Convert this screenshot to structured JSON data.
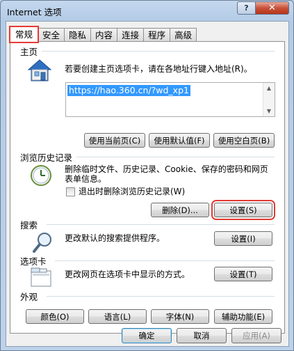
{
  "window": {
    "title": "Internet 选项",
    "help_label": "?",
    "close_label": "✕"
  },
  "tabs": [
    {
      "label": "常规"
    },
    {
      "label": "安全"
    },
    {
      "label": "隐私"
    },
    {
      "label": "内容"
    },
    {
      "label": "连接"
    },
    {
      "label": "程序"
    },
    {
      "label": "高级"
    }
  ],
  "homepage": {
    "section_title": "主页",
    "description": "若要创建主页选项卡，请在各地址行键入地址(R)。",
    "url": "https://hao.360.cn/?wd_xp1",
    "btn_current": "使用当前页(C)",
    "btn_default": "使用默认值(F)",
    "btn_blank": "使用空白页(B)"
  },
  "history": {
    "section_title": "浏览历史记录",
    "description_line1": "删除临时文件、历史记录、Cookie、保存的密码和网页",
    "description_line2": "表单信息。",
    "checkbox_label": "退出时删除浏览历史记录(W)",
    "btn_delete": "删除(D)...",
    "btn_settings": "设置(S)"
  },
  "search": {
    "section_title": "搜索",
    "description": "更改默认的搜索提供程序。",
    "btn_settings": "设置(I)"
  },
  "tabs_section": {
    "section_title": "选项卡",
    "description": "更改网页在选项卡中显示的方式。",
    "btn_settings": "设置(T)"
  },
  "appearance": {
    "section_title": "外观",
    "btn_colors": "颜色(O)",
    "btn_languages": "语言(L)",
    "btn_fonts": "字体(N)",
    "btn_accessibility": "辅助功能(E)"
  },
  "footer": {
    "ok": "确定",
    "cancel": "取消",
    "apply": "应用(A)"
  },
  "colors": {
    "highlight": "#e53a33",
    "selection": "#3399ff"
  }
}
